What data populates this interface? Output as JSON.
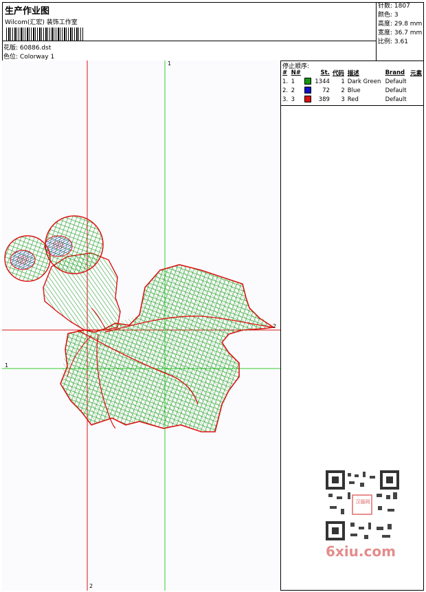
{
  "header": {
    "title": "生产作业图",
    "company": "Wilcom(汇宏) 装饰工作室",
    "design_label": "花版:",
    "design_value": "60886.dst",
    "colorway_label": "色位:",
    "colorway_value": "Colorway 1"
  },
  "info": {
    "stitches": "针数: 1807",
    "colors": "颜色: 3",
    "height": "高度: 29.8 mm",
    "width": "宽度: 36.7 mm",
    "scale": "比例: 3.61"
  },
  "stop_sequence": {
    "title": "停止顺序:",
    "headers": [
      "#",
      "N#",
      "St.",
      "代码",
      "描述",
      "Brand",
      "元素"
    ],
    "rows": [
      {
        "idx": "1.",
        "n": "1",
        "color": "#119911",
        "st": "1344",
        "code": "1",
        "desc": "Dark Green",
        "brand": "Default"
      },
      {
        "idx": "2.",
        "n": "2",
        "color": "#1111cc",
        "st": "72",
        "code": "2",
        "desc": "Blue",
        "brand": "Default"
      },
      {
        "idx": "3.",
        "n": "3",
        "color": "#dd1111",
        "st": "389",
        "code": "3",
        "desc": "Red",
        "brand": "Default"
      }
    ]
  },
  "canvas": {
    "guide_labels": {
      "top": "1",
      "left": "1",
      "bottom": "2",
      "right": "2"
    }
  },
  "watermark": {
    "text": "6xiu.com",
    "qr_center": "汉服网"
  },
  "colors": {
    "green": "#119911",
    "red": "#dd1111",
    "blue": "#1111cc",
    "guide_green": "#33cc33"
  }
}
